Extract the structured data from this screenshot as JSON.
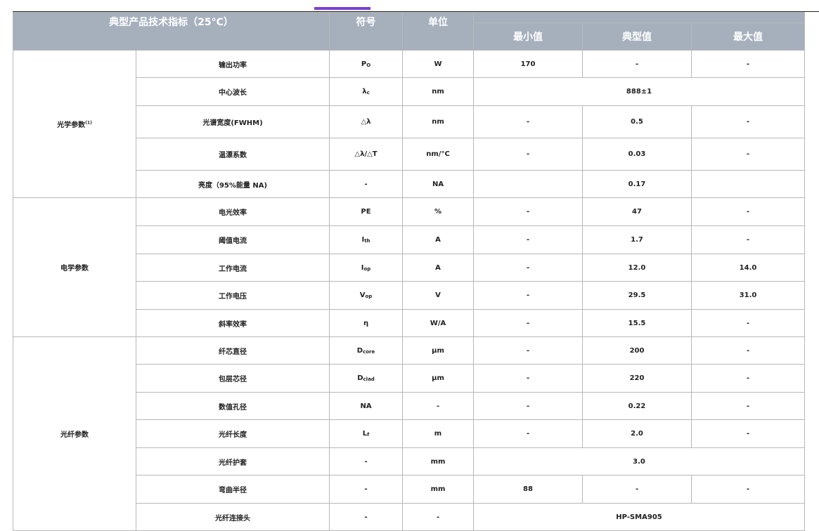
{
  "colors": {
    "header_bg": "#a6b0bd",
    "accent": "#7b3fd4"
  },
  "header": {
    "title": "典型产品技术指标（25°C）",
    "symbol": "符号",
    "unit": "单位",
    "min": "最小值",
    "typ": "典型值",
    "max": "最大值"
  },
  "groups": {
    "optical": {
      "label": "光学参数",
      "note": "(1)"
    },
    "electrical": {
      "label": "电学参数"
    },
    "fiber": {
      "label": "光纤参数"
    }
  },
  "rows": [
    {
      "param": "输出功率",
      "symbol": "P",
      "symbol_sub": "O",
      "unit": "W",
      "min": "170",
      "typ": "-",
      "max": "-"
    },
    {
      "param": "中心波长",
      "symbol": "λ",
      "symbol_sub": "c",
      "unit": "nm",
      "span": "888±1"
    },
    {
      "param": "光谱宽度(FWHM)",
      "symbol": "△λ",
      "symbol_sub": "",
      "unit": "nm",
      "min": "-",
      "typ": "0.5",
      "max": "-"
    },
    {
      "param": "温漂系数",
      "symbol": "△λ/△T",
      "symbol_sub": "",
      "unit": "nm/°C",
      "min": "-",
      "typ": "0.03",
      "max": "-"
    },
    {
      "param": "亮度（95%能量 NA)",
      "symbol": "-",
      "symbol_sub": "",
      "unit": "NA",
      "min": "",
      "typ": "0.17",
      "max": ""
    },
    {
      "param": "电光效率",
      "symbol": "PE",
      "symbol_sub": "",
      "unit": "%",
      "min": "-",
      "typ": "47",
      "max": "-"
    },
    {
      "param": "阈值电流",
      "symbol": "I",
      "symbol_sub": "th",
      "unit": "A",
      "min": "-",
      "typ": "1.7",
      "max": "-"
    },
    {
      "param": "工作电流",
      "symbol": "I",
      "symbol_sub": "op",
      "unit": "A",
      "min": "-",
      "typ": "12.0",
      "max": "14.0"
    },
    {
      "param": "工作电压",
      "symbol": "V",
      "symbol_sub": "op",
      "unit": "V",
      "min": "-",
      "typ": "29.5",
      "max": "31.0"
    },
    {
      "param": "斜率效率",
      "symbol": "η",
      "symbol_sub": "",
      "unit": "W/A",
      "min": "-",
      "typ": "15.5",
      "max": "-"
    },
    {
      "param": "纤芯直径",
      "symbol": "D",
      "symbol_sub": "core",
      "unit": "μm",
      "min": "-",
      "typ": "200",
      "max": "-"
    },
    {
      "param": "包层芯径",
      "symbol": "D",
      "symbol_sub": "clad",
      "unit": "μm",
      "min": "-",
      "typ": "220",
      "max": "-"
    },
    {
      "param": "数值孔径",
      "symbol": "NA",
      "symbol_sub": "",
      "unit": "-",
      "min": "-",
      "typ": "0.22",
      "max": "-"
    },
    {
      "param": "光纤长度",
      "symbol": "L",
      "symbol_sub": "f",
      "unit": "m",
      "min": "-",
      "typ": "2.0",
      "max": "-"
    },
    {
      "param": "光纤护套",
      "symbol": "-",
      "symbol_sub": "",
      "unit": "mm",
      "span": "3.0"
    },
    {
      "param": "弯曲半径",
      "symbol": "-",
      "symbol_sub": "",
      "unit": "mm",
      "min": "88",
      "typ": "-",
      "max": "-"
    },
    {
      "param": "光纤连接头",
      "symbol": "-",
      "symbol_sub": "",
      "unit": "-",
      "span": "HP-SMA905"
    }
  ]
}
